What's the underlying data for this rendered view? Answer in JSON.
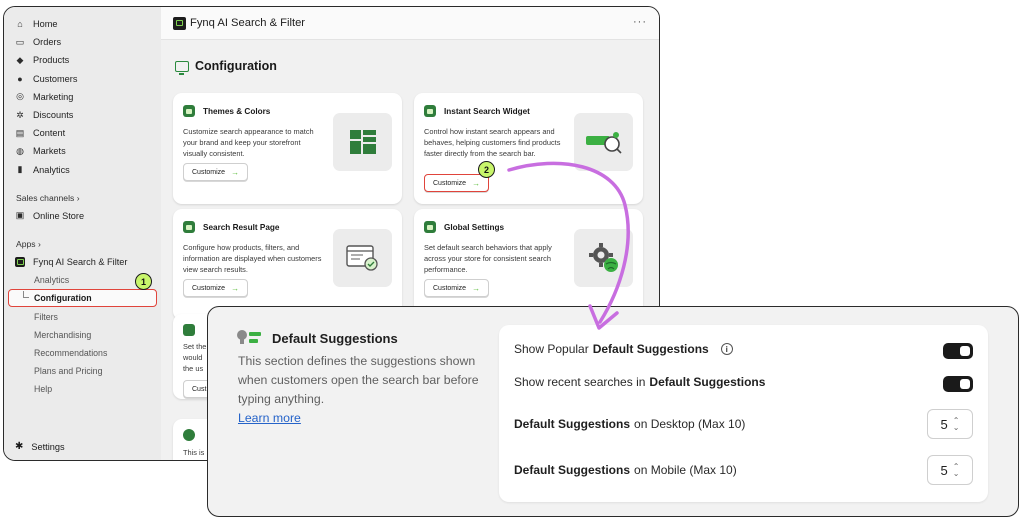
{
  "sidebar": {
    "nav": [
      {
        "icon": "home-icon",
        "glyph": "⌂",
        "label": "Home"
      },
      {
        "icon": "orders-icon",
        "glyph": "▭",
        "label": "Orders"
      },
      {
        "icon": "tag-icon",
        "glyph": "◆",
        "label": "Products"
      },
      {
        "icon": "person-icon",
        "glyph": "●",
        "label": "Customers"
      },
      {
        "icon": "target-icon",
        "glyph": "◎",
        "label": "Marketing"
      },
      {
        "icon": "discount-icon",
        "glyph": "✲",
        "label": "Discounts"
      },
      {
        "icon": "content-icon",
        "glyph": "▤",
        "label": "Content"
      },
      {
        "icon": "globe-icon",
        "glyph": "◍",
        "label": "Markets"
      },
      {
        "icon": "bar-chart-icon",
        "glyph": "▮",
        "label": "Analytics"
      }
    ],
    "sales_channels_label": "Sales channels",
    "online_store_label": "Online Store",
    "apps_label": "Apps",
    "app_name": "Fynq AI Search & Filter",
    "app_items": [
      "Analytics",
      "Configuration",
      "Filters",
      "Merchandising",
      "Recommendations",
      "Plans and Pricing",
      "Help"
    ],
    "settings_label": "Settings"
  },
  "topbar": {
    "title": "Fynq AI Search & Filter",
    "more": "···"
  },
  "page": {
    "title": "Configuration"
  },
  "cards": [
    {
      "title": "Themes & Colors",
      "desc": "Customize search appearance to match your brand and keep your storefront visually consistent.",
      "button": "Customize",
      "arrow": "→"
    },
    {
      "title": "Instant Search Widget",
      "desc": "Control how instant search appears and behaves, helping customers find products faster directly from the search bar.",
      "button": "Customize",
      "arrow": "→"
    },
    {
      "title": "Search Result Page",
      "desc": "Configure how products, filters, and information are displayed when customers view search results.",
      "button": "Customize",
      "arrow": "→"
    },
    {
      "title": "Global Settings",
      "desc": "Set default search behaviors that apply across your store for consistent search performance.",
      "button": "Customize",
      "arrow": "→"
    }
  ],
  "partial_fragments": {
    "line1": "Set the",
    "line2": "would",
    "line3": "the us",
    "button": "Cust",
    "bottom": "This is"
  },
  "markers": {
    "one": "1",
    "two": "2"
  },
  "overlay": {
    "title": "Default Suggestions",
    "description": "This section defines the suggestions shown when customers open the search bar before typing anything.",
    "link": "Learn more",
    "rows": {
      "popular_pre": "Show Popular",
      "popular_bold": "Default Suggestions",
      "recent_pre": "Show recent searches in",
      "recent_bold": "Default Suggestions",
      "desktop_bold": "Default Suggestions",
      "desktop_post": "on Desktop (Max 10)",
      "desktop_value": "5",
      "mobile_bold": "Default Suggestions",
      "mobile_post": "on Mobile (Max 10)",
      "mobile_value": "5"
    }
  },
  "colors": {
    "accent_green": "#2f7d3b",
    "marker_lime": "#c8f56b",
    "highlight_red": "#e0443b",
    "arrow_purple": "#c86ee0"
  }
}
